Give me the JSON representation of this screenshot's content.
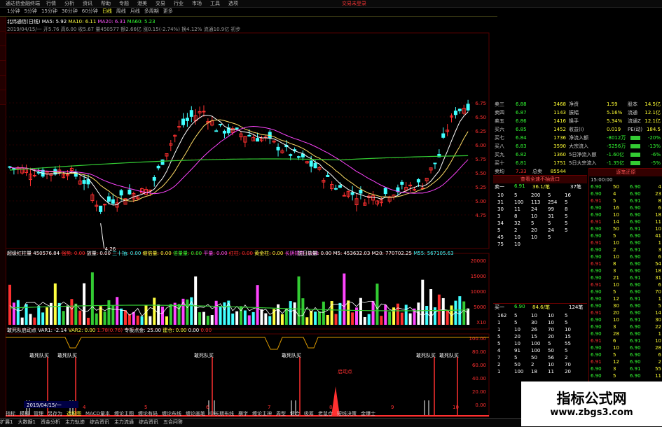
{
  "window": {
    "title": "通达信金融终端",
    "menu": [
      "行情",
      "分析",
      "资讯",
      "帮助",
      "专题",
      "港美",
      "交易",
      "行业",
      "市场",
      "工具",
      "选项"
    ],
    "right": "交易未登录"
  },
  "periods": [
    "1分钟",
    "5分钟",
    "15分钟",
    "30分钟",
    "60分钟",
    "日线",
    "周线",
    "月线",
    "多周期",
    "更多"
  ],
  "kline_head": {
    "name": "北纬通信(日线)",
    "ma5": "MA5: 5.92",
    "ma10": "MA10: 6.11",
    "ma20": "MA20: 6.31",
    "ma60": "MA60: 5.23"
  },
  "kline_sub": "2019/04/15/一  开5.76 高6.00 收5.67 量450577 额2.66亿 涨0.15(-2.74%) 换4.12% 流通10.9亿 初步",
  "price_labels": [
    "6.75",
    "6.50",
    "6.25",
    "6.00",
    "5.75",
    "5.50",
    "5.25",
    "5.00",
    "4.75"
  ],
  "kline_low": "4.26",
  "vol_head": {
    "name": "超级红柱量",
    "val": "450576.84",
    "a": "强势: 0.00",
    "b": "放量: 0.00",
    "c": "三十抽: 0.00",
    "d": "缩倍量: 0.00",
    "e": "倍量量: 0.00",
    "f": "平量: 0.00",
    "g": "红柱: 0.00",
    "h": "黄金柱: 0.00",
    "i": "长阴短柱: 0.00",
    "j": "前日放量: 0.00",
    "k": "M5: 453632.03",
    "l": "M20: 770702.25",
    "m": "M55: 567105.63"
  },
  "vol_labels": [
    "20000",
    "15000",
    "10000",
    "5000",
    "X10"
  ],
  "ind_head": {
    "name": "敢死队启动点",
    "v1": "VAR1: -2.14",
    "v2": "VAR2: 0.00",
    "v3": "1.78(0.76)",
    "v4": "专板点金: 25.00",
    "v5": "建仓: 0.00",
    "v6": "0.00",
    "v7": "0.00"
  },
  "ind_labels": [
    "100.00",
    "80.00",
    "60.00",
    "40.00",
    "20.00",
    "0.00"
  ],
  "ind_marks": {
    "dsd": "敢死队买",
    "qd": "启动点"
  },
  "date_cursor": "2019/04/15/一",
  "x_ticks": [
    "4",
    "5",
    "6",
    "7",
    "8",
    "9",
    "10"
  ],
  "orderbook": [
    {
      "k": "卖三",
      "p": "6.88",
      "v": "3468"
    },
    {
      "k": "卖四",
      "p": "6.87",
      "v": "1143"
    },
    {
      "k": "卖五",
      "p": "6.86",
      "v": "1416"
    },
    {
      "k": "买六",
      "p": "6.85",
      "v": "1452"
    },
    {
      "k": "买七",
      "p": "6.84",
      "v": "1736"
    },
    {
      "k": "买八",
      "p": "6.83",
      "v": "3590"
    },
    {
      "k": "买九",
      "p": "6.82",
      "v": "1360"
    },
    {
      "k": "买十",
      "p": "6.81",
      "v": "1751"
    },
    {
      "k": "卖均",
      "p": "7.33",
      "v": "85544"
    },
    {
      "k": "买均",
      "p": "6.81",
      "v": "48445"
    }
  ],
  "orderbook_right": [
    "总卖",
    "总买"
  ],
  "stats": [
    {
      "a": "净资",
      "b": "1.59",
      "c": "股本",
      "d": "14.5亿"
    },
    {
      "a": "振幅",
      "b": "5.16%",
      "c": "流通",
      "d": "12.1亿"
    },
    {
      "a": "换手",
      "b": "5.34%",
      "c": "流通Z",
      "d": "12.1亿"
    },
    {
      "a": "收益(I)",
      "b": "0.019",
      "c": "PE(动)",
      "d": "184.5"
    },
    {
      "a": "净流入额",
      "b": "-8012万",
      "c": "",
      "d": "-20%"
    },
    {
      "a": "大宗流入",
      "b": "-5256万",
      "c": "",
      "d": "-13%"
    },
    {
      "a": "5日净流入额",
      "b": "-1.60亿",
      "c": "",
      "d": "-6%"
    },
    {
      "a": "5日大宗流入",
      "b": "-1.35亿",
      "c": "",
      "d": "-5%"
    }
  ],
  "panel_title": "查看全速不抽盘口",
  "sell_header": {
    "a": "卖一",
    "b": "6.91",
    "c": "36.1/笔",
    "d": "37笔"
  },
  "buy_header": {
    "a": "买一",
    "b": "6.90",
    "c": "84.6/笔",
    "d": "124笔"
  },
  "sell_rows": [
    [
      "10",
      "5",
      "200",
      "5",
      "16"
    ],
    [
      "31",
      "100",
      "113",
      "254",
      "5"
    ],
    [
      "30",
      "11",
      "24",
      "99",
      "8"
    ],
    [
      "3",
      "8",
      "10",
      "31",
      "5"
    ],
    [
      "34",
      "32",
      "5",
      "5",
      "5"
    ],
    [
      "5",
      "2",
      "20",
      "24",
      "5"
    ],
    [
      "45",
      "10",
      "10",
      "5",
      ""
    ],
    [
      "75",
      "10",
      "",
      "",
      " "
    ]
  ],
  "buy_rows": [
    [
      "162",
      "5",
      "10",
      "10",
      "5"
    ],
    [
      "1",
      "5",
      "30",
      "10",
      "5"
    ],
    [
      "1",
      "10",
      "26",
      "70",
      "10"
    ],
    [
      "5",
      "20",
      "15",
      "20",
      "15"
    ],
    [
      "5",
      "10",
      "100",
      "5",
      "55"
    ],
    [
      "4",
      "91",
      "100",
      "50",
      "5"
    ],
    [
      "7",
      "5",
      "50",
      "56",
      "2"
    ],
    [
      "2",
      "50",
      "2",
      "10",
      "70"
    ],
    [
      "1",
      "100",
      "18",
      "11",
      "20"
    ]
  ],
  "trades_header": "逐笔还原",
  "trades_time": "15:00:00",
  "trade_prices": [
    "6.90",
    "6.90",
    "6.91",
    "6.90",
    "6.90",
    "6.91",
    "6.90",
    "6.90",
    "6.91",
    "6.90",
    "6.90",
    "6.91",
    "6.90",
    "6.90",
    "6.91",
    "6.90",
    "6.90",
    "6.90",
    "6.91",
    "6.90",
    "6.90",
    "6.90",
    "6.91",
    "6.90",
    "6.90",
    "6.91",
    "6.90",
    "6.90",
    "6.90",
    "6.91",
    "6.90",
    "6.90",
    "6.91",
    "6.90",
    "6.90",
    "6.91",
    "6.90",
    "6.90",
    "6.91",
    "6.90",
    "6.90",
    "6.90",
    "6.91",
    "6.90"
  ],
  "trade_vols": [
    "50",
    "4",
    "5",
    "16",
    "10",
    "14",
    "50",
    "5",
    "10",
    "2",
    "10",
    "8",
    "3",
    "21",
    "10",
    "5",
    "12",
    "30",
    "20",
    "10",
    "3",
    "28",
    "6",
    "10",
    "5",
    "12",
    "3",
    "5",
    "35",
    "6",
    "5",
    "10",
    "70",
    "5",
    "3",
    "14",
    "10",
    "6",
    "2",
    "18",
    "3",
    "5",
    "3",
    "10"
  ],
  "trade_right": [
    "4",
    "23",
    "8",
    "6",
    "18",
    "11",
    "10",
    "41",
    "1",
    "3",
    "6",
    "54",
    "18",
    "31",
    "6",
    "70",
    "1",
    "5",
    "14",
    "30",
    "22",
    "1",
    "10",
    "28",
    "6",
    "2",
    "55",
    "11",
    "16",
    "3",
    "5",
    "14",
    "10",
    "7",
    "46",
    "19",
    "12",
    "3",
    "24",
    "1",
    "6",
    "15",
    "2",
    "11"
  ],
  "tabs": [
    "指标",
    "模板",
    "管理",
    "另存为",
    "选股图",
    "MACD量本",
    "缠论主图",
    "缠论有码",
    "缠论布线",
    "缠论画笔",
    "中长期布线",
    "横字",
    "缠论主神",
    "周型",
    "健合",
    "吸筹",
    "老鼠仓",
    "短线决策",
    "金爆士"
  ],
  "bottom": [
    "扩展1",
    "大数据1",
    "资金分析",
    "主力轨迹",
    "综合资讯",
    "主力流通",
    "综合资讯",
    "五合问答"
  ],
  "bottom_right": [
    "通达信",
    "上证",
    "1.75",
    "日线"
  ],
  "watermark": {
    "cn": "指标公式网",
    "url": "www.zbgs3.com"
  },
  "colors": {
    "up": "#ff3030",
    "down": "#40ffff",
    "ma5": "#ffffff",
    "ma10": "#ffdd66",
    "ma20": "#ff44ff",
    "ma60": "#33cc33",
    "grid": "#550000"
  }
}
